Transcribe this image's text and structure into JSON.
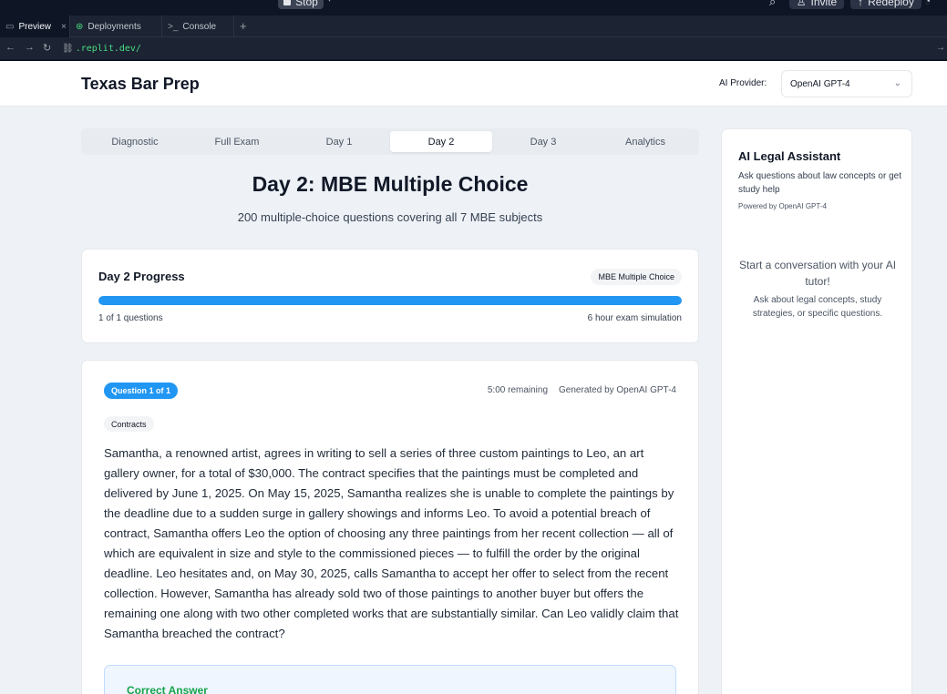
{
  "ide": {
    "stop_label": "Stop",
    "invite_label": "Invite",
    "redeploy_label": "Redeploy",
    "tabs": [
      {
        "label": "Preview",
        "icon": "monitor-icon"
      },
      {
        "label": "Deployments",
        "icon": "deploy-icon"
      },
      {
        "label": "Console",
        "icon": "terminal-icon"
      }
    ],
    "url": ".replit.dev/"
  },
  "header": {
    "title": "Texas Bar Prep",
    "provider_label": "AI Provider:",
    "provider_value": "OpenAI GPT-4"
  },
  "exam_tabs": [
    {
      "label": "Diagnostic"
    },
    {
      "label": "Full Exam"
    },
    {
      "label": "Day 1"
    },
    {
      "label": "Day 2"
    },
    {
      "label": "Day 3"
    },
    {
      "label": "Analytics"
    }
  ],
  "active_tab": "Day 2",
  "day": {
    "title": "Day 2: MBE Multiple Choice",
    "subtitle": "200 multiple-choice questions covering all 7 MBE subjects"
  },
  "progress": {
    "title": "Day 2 Progress",
    "badge": "MBE Multiple Choice",
    "fraction": 1.0,
    "count_text": "1 of 1 questions",
    "simulation_text": "6 hour exam simulation",
    "bar_color": "#2196f3"
  },
  "question": {
    "badge": "Question 1 of 1",
    "time_remaining": "5:00 remaining",
    "generated_by": "Generated by OpenAI GPT-4",
    "subject": "Contracts",
    "text": "Samantha, a renowned artist, agrees in writing to sell a series of three custom paintings to Leo, an art gallery owner, for a total of $30,000. The contract specifies that the paintings must be completed and delivered by June 1, 2025. On May 15, 2025, Samantha realizes she is unable to complete the paintings by the deadline due to a sudden surge in gallery showings and informs Leo. To avoid a potential breach of contract, Samantha offers Leo the option of choosing any three paintings from her recent collection — all of which are equivalent in size and style to the commissioned pieces — to fulfill the order by the original deadline. Leo hesitates and, on May 30, 2025, calls Samantha to accept her offer to select from the recent collection. However, Samantha has already sold two of those paintings to another buyer but offers the remaining one along with two other completed works that are substantially similar. Can Leo validly claim that Samantha breached the contract?",
    "answer_label": "Correct Answer"
  },
  "assistant": {
    "title": "AI Legal Assistant",
    "description": "Ask questions about law concepts or get study help",
    "powered_by": "Powered by OpenAI GPT-4",
    "empty_title": "Start a conversation with your AI tutor!",
    "empty_hint": "Ask about legal concepts, study strategies, or specific questions."
  }
}
